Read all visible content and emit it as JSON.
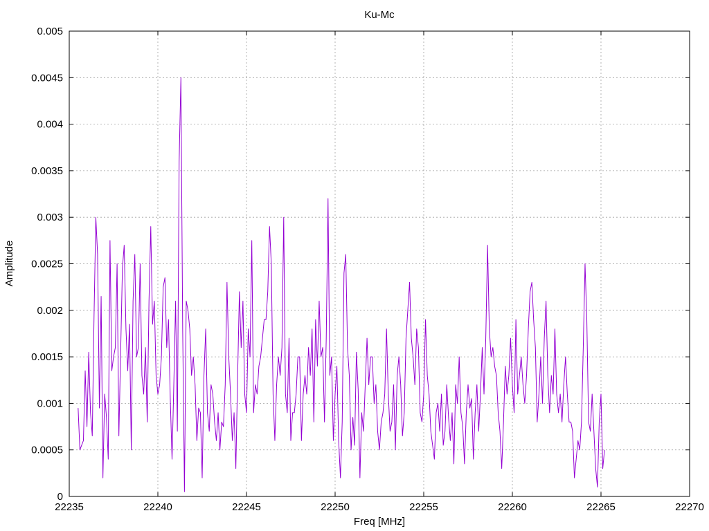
{
  "chart_data": {
    "type": "line",
    "title": "Ku-Mc",
    "xlabel": "Freq [MHz]",
    "ylabel": "Amplitude",
    "xlim": [
      22235,
      22270
    ],
    "ylim": [
      0,
      0.005
    ],
    "x_ticks": [
      "22235",
      "22240",
      "22245",
      "22250",
      "22255",
      "22260",
      "22265",
      "22270"
    ],
    "y_ticks": [
      "0",
      "0.0005",
      "0.001",
      "0.0015",
      "0.002",
      "0.0025",
      "0.003",
      "0.0035",
      "0.004",
      "0.0045",
      "0.005"
    ],
    "grid": true,
    "legend": "none",
    "series": [
      {
        "color": "#9400d3",
        "x_start": 22235.5,
        "x_step": 0.1,
        "values": [
          0.00095,
          0.0005,
          0.00055,
          0.0006,
          0.00135,
          0.00075,
          0.00155,
          0.0009,
          0.00065,
          0.00195,
          0.003,
          0.0026,
          0.00095,
          0.00215,
          0.0002,
          0.0011,
          0.00085,
          0.0004,
          0.00275,
          0.00135,
          0.0015,
          0.0016,
          0.0025,
          0.00065,
          0.00155,
          0.00245,
          0.0027,
          0.0018,
          0.00135,
          0.00185,
          0.0005,
          0.0021,
          0.0026,
          0.0015,
          0.0016,
          0.0025,
          0.0013,
          0.0011,
          0.0016,
          0.0008,
          0.0021,
          0.0029,
          0.00185,
          0.0021,
          0.0013,
          0.0011,
          0.0012,
          0.0015,
          0.00225,
          0.00235,
          0.0016,
          0.0019,
          0.00105,
          0.0004,
          0.0012,
          0.0021,
          0.0007,
          0.0036,
          0.0045,
          0.0018,
          5e-05,
          0.0021,
          0.002,
          0.0018,
          0.0013,
          0.0015,
          0.0012,
          0.0006,
          0.00095,
          0.0009,
          0.0002,
          0.0013,
          0.0018,
          0.0009,
          0.0007,
          0.0012,
          0.0011,
          0.0008,
          0.0006,
          0.0009,
          0.0005,
          0.0008,
          0.00075,
          0.0012,
          0.0023,
          0.0015,
          0.0011,
          0.0006,
          0.0009,
          0.0003,
          0.0013,
          0.0022,
          0.0016,
          0.0021,
          0.0011,
          0.0009,
          0.0018,
          0.0015,
          0.00275,
          0.0009,
          0.0012,
          0.0011,
          0.0014,
          0.0015,
          0.0017,
          0.0019,
          0.0019,
          0.0022,
          0.0029,
          0.0025,
          0.0011,
          0.0006,
          0.0012,
          0.0015,
          0.0013,
          0.0016,
          0.003,
          0.0011,
          0.0009,
          0.0017,
          0.0006,
          0.0009,
          0.0009,
          0.0011,
          0.0015,
          0.0015,
          0.0006,
          0.0011,
          0.0013,
          0.0011,
          0.0016,
          0.0013,
          0.0018,
          0.0008,
          0.0019,
          0.0014,
          0.0021,
          0.0015,
          0.0016,
          0.0008,
          0.0017,
          0.0032,
          0.0013,
          0.0015,
          0.0006,
          0.0011,
          0.0014,
          0.0006,
          0.0002,
          0.0008,
          0.0024,
          0.0026,
          0.0016,
          0.0013,
          0.0005,
          0.00085,
          0.00055,
          0.00155,
          0.00115,
          0.0002,
          0.0009,
          0.0007,
          0.0012,
          0.0017,
          0.0012,
          0.0015,
          0.0015,
          0.001,
          0.0012,
          0.0007,
          0.0005,
          0.0008,
          0.0009,
          0.0011,
          0.0018,
          0.0011,
          0.0007,
          0.0008,
          0.0012,
          0.0005,
          0.0013,
          0.0015,
          0.0012,
          0.00065,
          0.0009,
          0.0017,
          0.002,
          0.0023,
          0.0017,
          0.0015,
          0.0012,
          0.0018,
          0.0016,
          0.0009,
          0.0008,
          0.0011,
          0.0019,
          0.0013,
          0.0011,
          0.0007,
          0.00055,
          0.0004,
          0.0009,
          0.001,
          0.0007,
          0.0011,
          0.00055,
          0.0007,
          0.0012,
          0.00085,
          0.0006,
          0.0009,
          0.00035,
          0.0012,
          0.001,
          0.0015,
          0.0009,
          0.00075,
          0.00035,
          0.0009,
          0.0012,
          0.00095,
          0.00105,
          0.0004,
          0.0009,
          0.0012,
          0.0007,
          0.0011,
          0.0016,
          0.0011,
          0.0017,
          0.0027,
          0.0018,
          0.0015,
          0.0016,
          0.0014,
          0.0013,
          0.0009,
          0.0007,
          0.0003,
          0.0008,
          0.0014,
          0.0011,
          0.0013,
          0.0017,
          0.0012,
          0.0009,
          0.0019,
          0.0011,
          0.0013,
          0.0015,
          0.0012,
          0.001,
          0.0013,
          0.0018,
          0.0022,
          0.0023,
          0.0019,
          0.0016,
          0.0008,
          0.0011,
          0.0015,
          0.001,
          0.0017,
          0.0021,
          0.0013,
          0.0009,
          0.0013,
          0.0011,
          0.0018,
          0.0011,
          0.0009,
          0.0011,
          0.0008,
          0.0012,
          0.0015,
          0.0011,
          0.0008,
          0.0008,
          0.0007,
          0.0002,
          0.0004,
          0.0006,
          0.0005,
          0.0008,
          0.0016,
          0.0025,
          0.0019,
          0.0008,
          0.0007,
          0.0011,
          0.0007,
          0.0003,
          0.0001,
          0.0008,
          0.0011,
          0.0003,
          0.0005
        ]
      }
    ]
  }
}
